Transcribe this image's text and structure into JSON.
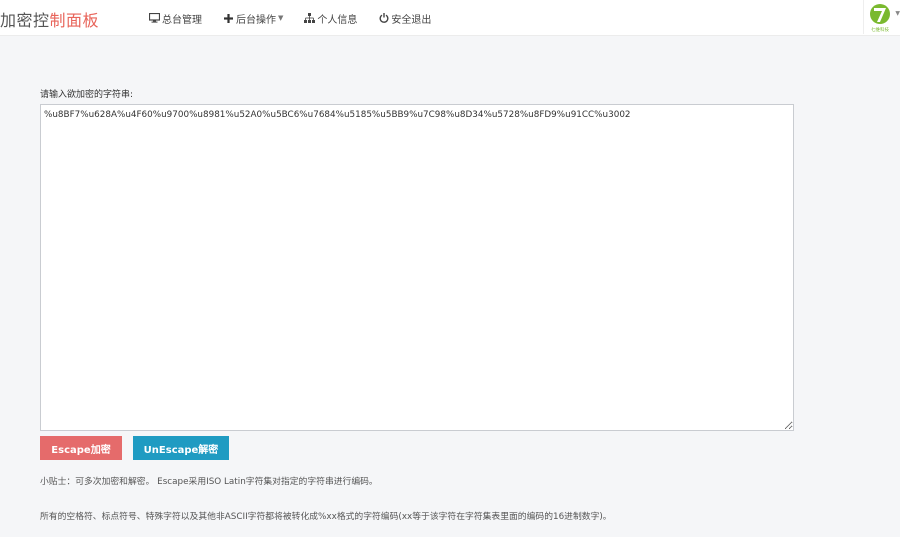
{
  "header": {
    "brand_part1": "加密控",
    "brand_part2": "制面板",
    "nav": [
      {
        "label": "总台管理",
        "icon": "monitor-icon"
      },
      {
        "label": "后台操作",
        "icon": "plus-icon",
        "dropdown": true
      },
      {
        "label": "个人信息",
        "icon": "sitemap-icon"
      },
      {
        "label": "安全退出",
        "icon": "power-icon"
      }
    ],
    "logo_caption": "七维科技"
  },
  "form": {
    "prompt_label": "请输入欲加密的字符串:",
    "input_value": "%u8BF7%u628A%u4F60%u9700%u8981%u52A0%u5BC6%u7684%u5185%u5BB9%u7C98%u8D34%u5728%u8FD9%u91CC%u3002"
  },
  "buttons": {
    "escape_label": "Escape加密",
    "unescape_label": "UnEscape解密"
  },
  "tips": {
    "line1": "小贴士：可多次加密和解密。 Escape采用ISO Latin字符集对指定的字符串进行编码。",
    "line2": "所有的空格符、标点符号、特殊字符以及其他非ASCII字符都将被转化成%xx格式的字符编码(xx等于该字符在字符集表里面的编码的16进制数字)。"
  },
  "colors": {
    "brand_accent": "#e8645a",
    "escape_button": "#e56b6b",
    "unescape_button": "#1f9bc2",
    "logo_green": "#7ab92f"
  }
}
